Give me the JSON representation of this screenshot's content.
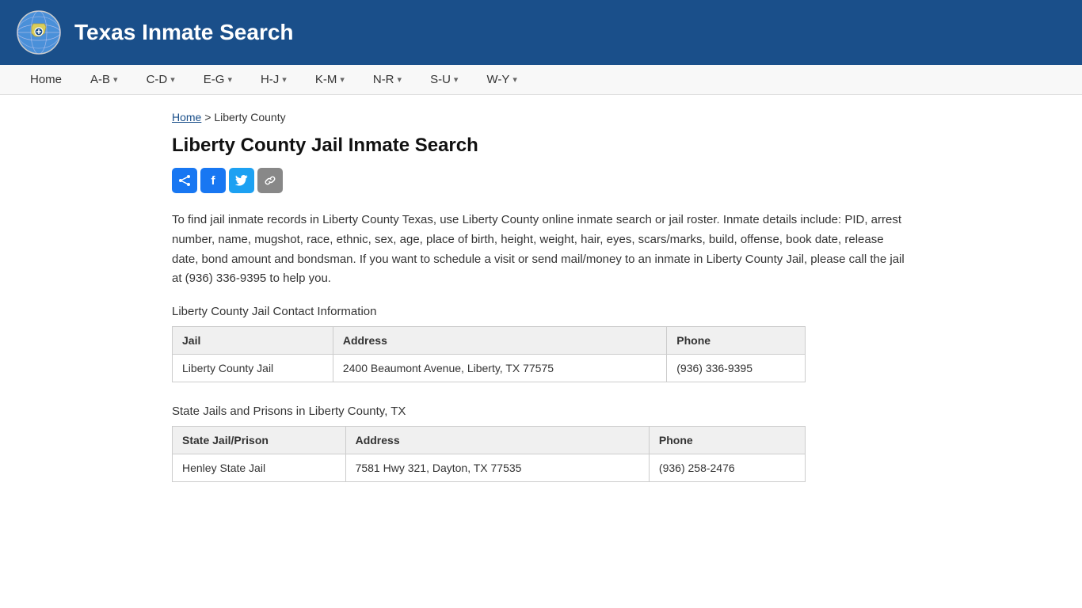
{
  "header": {
    "title": "Texas Inmate Search",
    "logo_alt": "Texas globe icon"
  },
  "nav": {
    "items": [
      {
        "label": "Home",
        "has_dropdown": false
      },
      {
        "label": "A-B",
        "has_dropdown": true
      },
      {
        "label": "C-D",
        "has_dropdown": true
      },
      {
        "label": "E-G",
        "has_dropdown": true
      },
      {
        "label": "H-J",
        "has_dropdown": true
      },
      {
        "label": "K-M",
        "has_dropdown": true
      },
      {
        "label": "N-R",
        "has_dropdown": true
      },
      {
        "label": "S-U",
        "has_dropdown": true
      },
      {
        "label": "W-Y",
        "has_dropdown": true
      }
    ]
  },
  "breadcrumb": {
    "home_label": "Home",
    "separator": ">",
    "current": "Liberty County"
  },
  "page": {
    "title": "Liberty County Jail Inmate Search",
    "description": "To find jail inmate records in Liberty County Texas, use Liberty County online inmate search or jail roster. Inmate details include: PID, arrest number, name, mugshot, race, ethnic, sex, age, place of birth, height, weight, hair, eyes, scars/marks, build, offense, book date, release date, bond amount and bondsman. If you want to schedule a visit or send mail/money to an inmate in Liberty County Jail, please call the jail at (936) 336-9395 to help you.",
    "jail_contact_label": "Liberty County Jail Contact Information",
    "state_jails_label": "State Jails and Prisons in Liberty County, TX"
  },
  "social": {
    "share_label": "f",
    "facebook_label": "f",
    "twitter_label": "𝕏",
    "link_label": "🔗"
  },
  "jail_table": {
    "headers": [
      "Jail",
      "Address",
      "Phone"
    ],
    "rows": [
      [
        "Liberty County Jail",
        "2400 Beaumont Avenue, Liberty, TX 77575",
        "(936) 336-9395"
      ]
    ]
  },
  "state_jails_table": {
    "headers": [
      "State Jail/Prison",
      "Address",
      "Phone"
    ],
    "rows": [
      [
        "Henley State Jail",
        "7581 Hwy 321, Dayton, TX 77535",
        "(936) 258-2476"
      ]
    ]
  }
}
